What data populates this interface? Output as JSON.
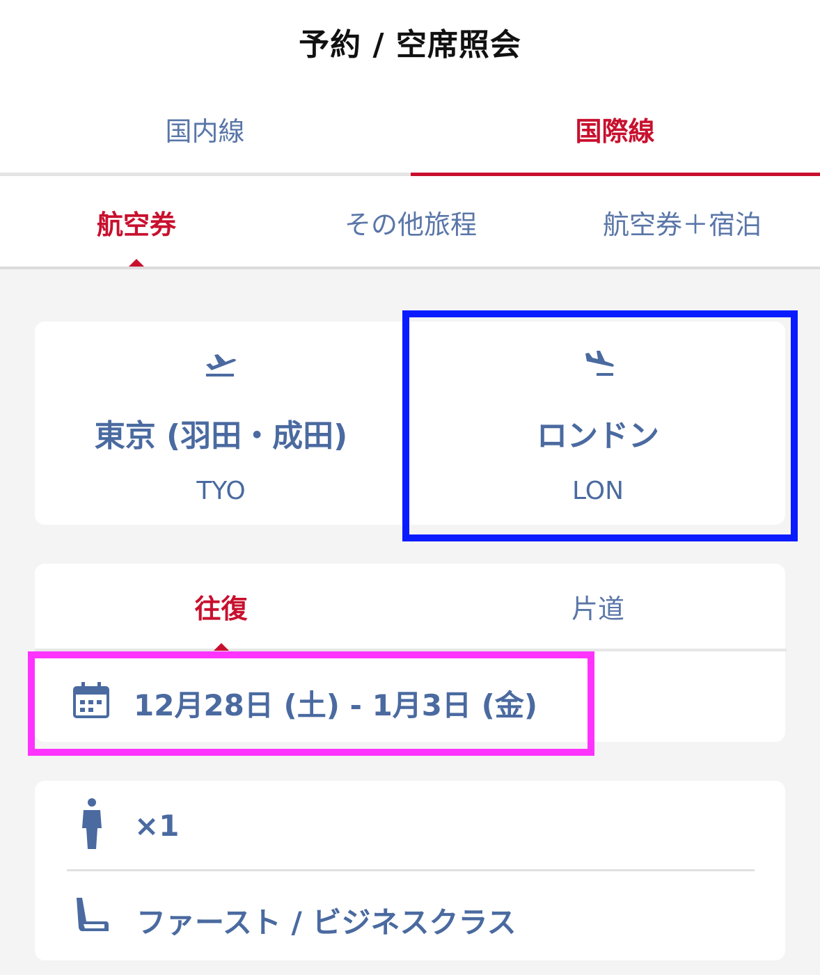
{
  "header": {
    "title": "予約 / 空席照会"
  },
  "tabs_primary": [
    {
      "label": "国内線",
      "active": false
    },
    {
      "label": "国際線",
      "active": true
    }
  ],
  "tabs_secondary": [
    {
      "label": "航空券",
      "active": true
    },
    {
      "label": "その他旅程",
      "active": false
    },
    {
      "label": "航空券＋宿泊",
      "active": false
    }
  ],
  "route": {
    "origin": {
      "city": "東京 (羽田・成田)",
      "code": "TYO",
      "icon": "departure-plane-icon"
    },
    "destination": {
      "city": "ロンドン",
      "code": "LON",
      "icon": "arrival-plane-icon"
    }
  },
  "trip_type": [
    {
      "label": "往復",
      "active": true
    },
    {
      "label": "片道",
      "active": false
    }
  ],
  "dates": {
    "value": "12月28日 (土) - 1月3日 (金)",
    "icon": "calendar-icon"
  },
  "passengers": {
    "value": "×1",
    "icon": "person-icon"
  },
  "cabin": {
    "value": "ファースト / ビジネスクラス",
    "icon": "seat-icon"
  },
  "colors": {
    "accent": "#c8102e",
    "text": "#4a6aa0",
    "highlight_blue": "#0a1cff",
    "highlight_pink": "#ff33ff"
  }
}
